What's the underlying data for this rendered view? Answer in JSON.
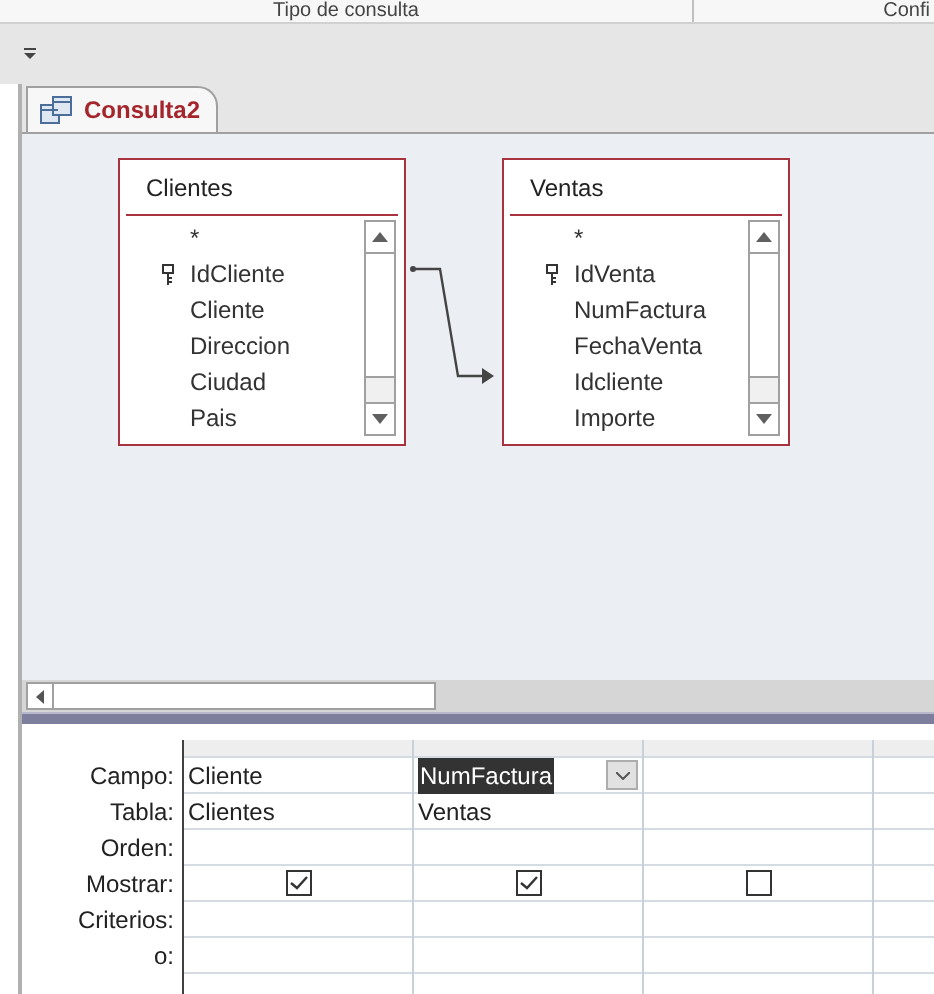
{
  "ribbon": {
    "groups": [
      "Tipo de consulta",
      "Confi"
    ]
  },
  "tab": {
    "label": "Consulta2",
    "selected": true
  },
  "tables": [
    {
      "title": "Clientes",
      "fields": [
        {
          "name": "*",
          "key": false
        },
        {
          "name": "IdCliente",
          "key": true
        },
        {
          "name": "Cliente",
          "key": false
        },
        {
          "name": "Direccion",
          "key": false
        },
        {
          "name": "Ciudad",
          "key": false
        },
        {
          "name": "Pais",
          "key": false
        }
      ]
    },
    {
      "title": "Ventas",
      "fields": [
        {
          "name": "*",
          "key": false
        },
        {
          "name": "IdVenta",
          "key": true
        },
        {
          "name": "NumFactura",
          "key": false
        },
        {
          "name": "FechaVenta",
          "key": false
        },
        {
          "name": "Idcliente",
          "key": false
        },
        {
          "name": "Importe",
          "key": false
        }
      ]
    }
  ],
  "grid": {
    "row_labels": [
      "Campo:",
      "Tabla:",
      "Orden:",
      "Mostrar:",
      "Criterios:",
      "o:"
    ],
    "columns": [
      {
        "campo": "Cliente",
        "tabla": "Clientes",
        "mostrar": true,
        "selected": false
      },
      {
        "campo": "NumFactura",
        "tabla": "Ventas",
        "mostrar": true,
        "selected": true
      },
      {
        "mostrar": false
      }
    ]
  }
}
